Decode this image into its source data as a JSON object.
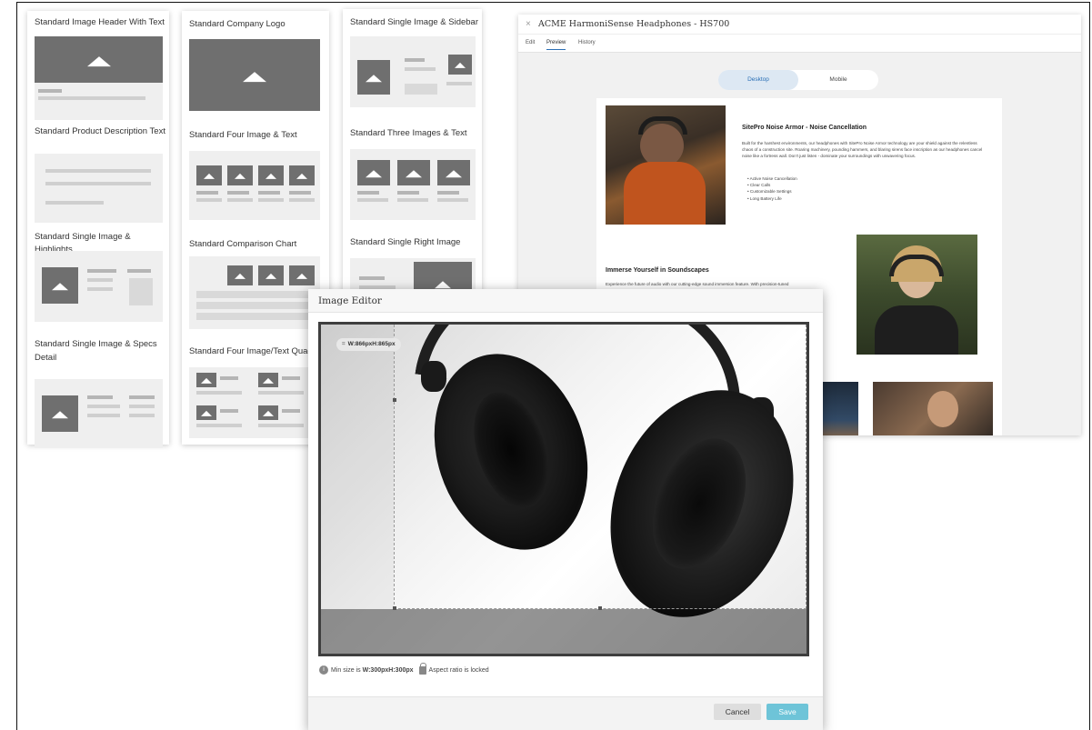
{
  "templates": {
    "col1": [
      {
        "title": "Standard Image Header With Text"
      },
      {
        "title": "Standard Product Description Text"
      },
      {
        "title": "Standard Single Image & Highlights"
      },
      {
        "title": "Standard Single Image & Specs Detail"
      }
    ],
    "col2": [
      {
        "title": "Standard Company Logo"
      },
      {
        "title": "Standard Four Image & Text"
      },
      {
        "title": "Standard Comparison Chart"
      },
      {
        "title": "Standard Four Image/Text Quad"
      }
    ],
    "col3": [
      {
        "title": "Standard Single Image & Sidebar"
      },
      {
        "title": "Standard Three Images & Text"
      },
      {
        "title": "Standard Single Right Image"
      }
    ]
  },
  "preview": {
    "close": "×",
    "title": "ACME HarmoniSense Headphones - HS700",
    "tabs": [
      "Edit",
      "Preview",
      "History"
    ],
    "active_tab": "Preview",
    "toggle": {
      "desktop": "Desktop",
      "mobile": "Mobile",
      "selected": "Desktop"
    },
    "section1": {
      "heading": "SitePro Noise Armor - Noise Cancellation",
      "body": "Built for the harshest environments, our headphones with SitePro Noise Armor technology are your shield against the relentless chaos of a construction site. Roaring machinery, pounding hammers, and blaring sirens face inscription as our headphones cancel noise like a fortress wall. Don't just listen - dominate your surroundings with unwavering focus.",
      "bullets": [
        "Active Noise Cancellation",
        "Clear Calls",
        "Customizable Settings",
        "Long Battery Life"
      ]
    },
    "section2": {
      "heading": "Immerse Yourself in Soundscapes",
      "body": "Experience the future of audio with our cutting-edge sound immersion feature. With precision-tuned"
    }
  },
  "editor": {
    "title": "Image Editor",
    "size_prefix": "W:",
    "size_value": "W:866pxH:865px",
    "info_prefix": "Min size is ",
    "info_size": "W:300pxH:300px",
    "aspect_text": "Aspect ratio is locked",
    "cancel_label": "Cancel",
    "save_label": "Save"
  },
  "icons": {
    "close": "close-icon",
    "crop": "crop-icon",
    "info": "info-icon",
    "lock": "lock-icon",
    "image_placeholder": "image-icon"
  },
  "colors": {
    "accent": "#2a6fb5",
    "save_button": "#6ec4d8",
    "placeholder_gray": "#6f6f6f"
  }
}
